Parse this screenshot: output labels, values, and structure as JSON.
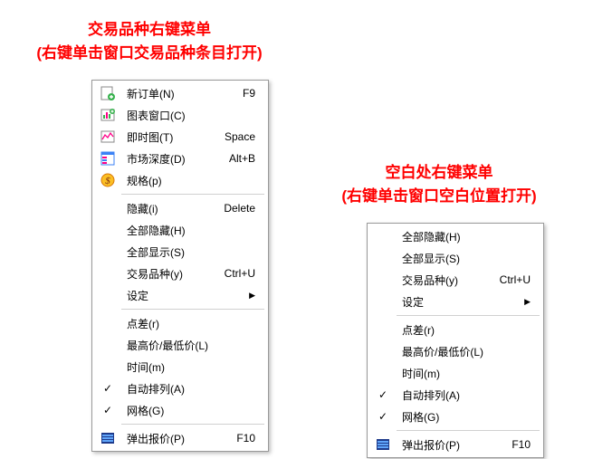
{
  "caption_left": {
    "line1": "交易品种右键菜单",
    "line2": "(右键单击窗口交易品种条目打开)"
  },
  "caption_right": {
    "line1": "空白处右键菜单",
    "line2": "(右键单击窗口空白位置打开)"
  },
  "menu_left": {
    "items": [
      {
        "label": "新订单(N)",
        "shortcut": "F9"
      },
      {
        "label": "图表窗口(C)"
      },
      {
        "label": "即时图(T)",
        "shortcut": "Space"
      },
      {
        "label": "市场深度(D)",
        "shortcut": "Alt+B"
      },
      {
        "label": "规格(p)"
      },
      {
        "label": "隐藏(i)",
        "shortcut": "Delete"
      },
      {
        "label": "全部隐藏(H)"
      },
      {
        "label": "全部显示(S)"
      },
      {
        "label": "交易品种(y)",
        "shortcut": "Ctrl+U"
      },
      {
        "label": "设定",
        "submenu": true
      },
      {
        "label": "点差(r)"
      },
      {
        "label": "最高价/最低价(L)"
      },
      {
        "label": "时间(m)"
      },
      {
        "label": "自动排列(A)",
        "checked": true
      },
      {
        "label": "网格(G)",
        "checked": true
      },
      {
        "label": "弹出报价(P)",
        "shortcut": "F10"
      }
    ]
  },
  "menu_right": {
    "items": [
      {
        "label": "全部隐藏(H)"
      },
      {
        "label": "全部显示(S)"
      },
      {
        "label": "交易品种(y)",
        "shortcut": "Ctrl+U"
      },
      {
        "label": "设定",
        "submenu": true
      },
      {
        "label": "点差(r)"
      },
      {
        "label": "最高价/最低价(L)"
      },
      {
        "label": "时间(m)"
      },
      {
        "label": "自动排列(A)",
        "checked": true
      },
      {
        "label": "网格(G)",
        "checked": true
      },
      {
        "label": "弹出报价(P)",
        "shortcut": "F10"
      }
    ]
  }
}
